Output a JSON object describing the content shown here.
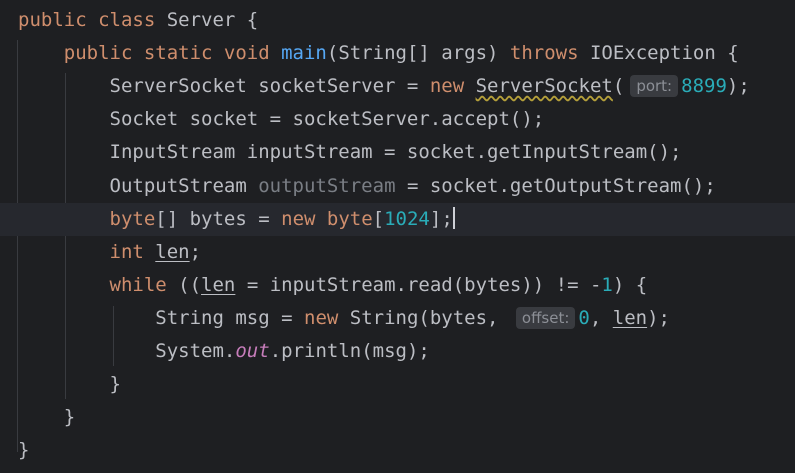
{
  "editor": {
    "lines": [
      {
        "indent": "",
        "tokens": [
          {
            "text": "public class ",
            "kind": "kw"
          },
          {
            "text": "Server {",
            "kind": "plain"
          }
        ]
      },
      {
        "indent": "    ",
        "tokens": [
          {
            "text": "public static void ",
            "kind": "kw"
          },
          {
            "text": "main",
            "kind": "fn"
          },
          {
            "text": "(String[] args) ",
            "kind": "plain"
          },
          {
            "text": "throws ",
            "kind": "kw"
          },
          {
            "text": "IOException {",
            "kind": "plain"
          }
        ]
      },
      {
        "indent": "        ",
        "tokens": [
          {
            "text": "ServerSocket socketServer = ",
            "kind": "plain"
          },
          {
            "text": "new ",
            "kind": "kw"
          },
          {
            "text": "ServerSocket",
            "kind": "wavy"
          },
          {
            "text": "(",
            "kind": "plain"
          },
          {
            "text": "port:",
            "kind": "hint"
          },
          {
            "text": "8899",
            "kind": "num"
          },
          {
            "text": ");",
            "kind": "plain"
          }
        ]
      },
      {
        "indent": "        ",
        "tokens": [
          {
            "text": "Socket socket = socketServer.accept();",
            "kind": "plain"
          }
        ]
      },
      {
        "indent": "        ",
        "tokens": [
          {
            "text": "InputStream inputStream = socket.getInputStream();",
            "kind": "plain"
          }
        ]
      },
      {
        "indent": "        ",
        "tokens": [
          {
            "text": "OutputStream ",
            "kind": "plain"
          },
          {
            "text": "outputStream",
            "kind": "dim"
          },
          {
            "text": " = socket.getOutputStream();",
            "kind": "plain"
          }
        ]
      },
      {
        "indent": "        ",
        "current": true,
        "tokens": [
          {
            "text": "byte",
            "kind": "kw"
          },
          {
            "text": "[] bytes = ",
            "kind": "plain"
          },
          {
            "text": "new ",
            "kind": "kw"
          },
          {
            "text": "byte",
            "kind": "kw"
          },
          {
            "text": "[",
            "kind": "plain"
          },
          {
            "text": "1024",
            "kind": "num"
          },
          {
            "text": "];",
            "kind": "plain"
          },
          {
            "text": "",
            "kind": "caret"
          }
        ]
      },
      {
        "indent": "        ",
        "tokens": [
          {
            "text": "int ",
            "kind": "kw"
          },
          {
            "text": "len",
            "kind": "underline"
          },
          {
            "text": ";",
            "kind": "plain"
          }
        ]
      },
      {
        "indent": "        ",
        "tokens": [
          {
            "text": "while ",
            "kind": "kw"
          },
          {
            "text": "((",
            "kind": "plain"
          },
          {
            "text": "len",
            "kind": "underline"
          },
          {
            "text": " = inputStream.read(bytes)) != -",
            "kind": "plain"
          },
          {
            "text": "1",
            "kind": "num"
          },
          {
            "text": ") {",
            "kind": "plain"
          }
        ]
      },
      {
        "indent": "            ",
        "tokens": [
          {
            "text": "String msg = ",
            "kind": "plain"
          },
          {
            "text": "new ",
            "kind": "kw"
          },
          {
            "text": "String(bytes, ",
            "kind": "plain"
          },
          {
            "text": "offset:",
            "kind": "hint"
          },
          {
            "text": "0",
            "kind": "num"
          },
          {
            "text": ", ",
            "kind": "plain"
          },
          {
            "text": "len",
            "kind": "underline"
          },
          {
            "text": ");",
            "kind": "plain"
          }
        ]
      },
      {
        "indent": "            ",
        "tokens": [
          {
            "text": "System.",
            "kind": "plain"
          },
          {
            "text": "out",
            "kind": "static-field"
          },
          {
            "text": ".println(msg);",
            "kind": "plain"
          }
        ]
      },
      {
        "indent": "        ",
        "tokens": [
          {
            "text": "}",
            "kind": "plain"
          }
        ]
      },
      {
        "indent": "    ",
        "tokens": [
          {
            "text": "}",
            "kind": "plain"
          }
        ]
      },
      {
        "indent": "",
        "tokens": [
          {
            "text": "}",
            "kind": "plain"
          }
        ]
      }
    ]
  },
  "theme": {
    "background": "#1e1f22",
    "current_line": "#26282e",
    "keyword": "#cf8e6d",
    "function": "#56a8f5",
    "number": "#2aacb8",
    "unused": "#7a7e85",
    "static_field": "#c77dbb",
    "text": "#bcbec4",
    "hint_bg": "#393b40"
  }
}
